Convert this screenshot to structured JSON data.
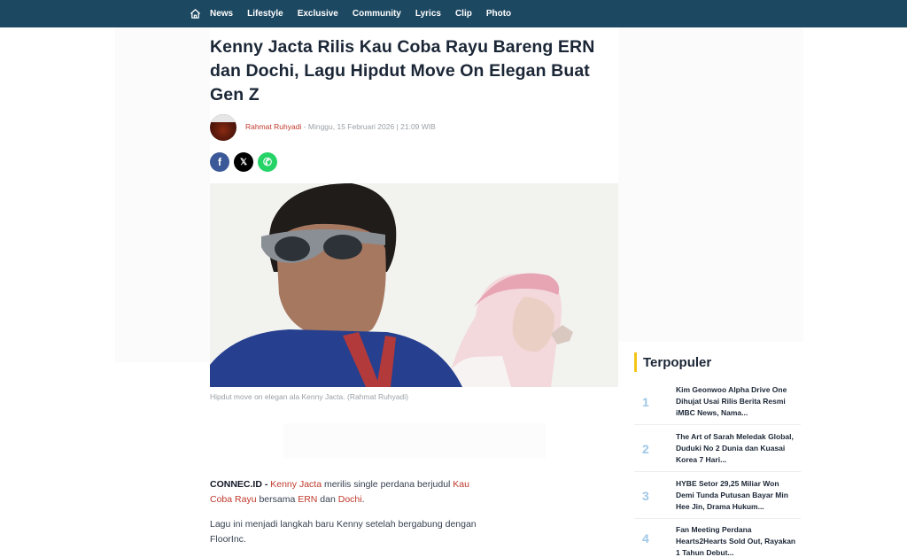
{
  "nav": {
    "home_icon": "home-icon",
    "items": [
      "News",
      "Lifestyle",
      "Exclusive",
      "Community",
      "Lyrics",
      "Clip",
      "Photo"
    ]
  },
  "article": {
    "title": "Kenny Jacta Rilis Kau Coba Rayu Bareng ERN dan Dochi, Lagu Hipdut Move On Elegan Buat Gen Z",
    "author": "Rahmat Ruhyadi",
    "date": " - Minggu, 15 Februari 2026 | 21:09 WIB",
    "share": {
      "facebook": "f",
      "x": "𝕏",
      "whatsapp": "✆"
    },
    "image_caption": "Hipdut move on elegan ala Kenny Jacta. (Rahmat Ruhyadi)",
    "p1": {
      "source": "CONNEC.ID - ",
      "link1": "Kenny Jacta",
      "text1": " merilis single perdana berjudul ",
      "link2": "Kau Coba Rayu",
      "text2": " bersama ",
      "link3": "ERN",
      "text3": " dan ",
      "link4": "Dochi",
      "text4": "."
    },
    "p2": "Lagu ini menjadi langkah baru Kenny setelah bergabung dengan FloorInc."
  },
  "sidebar": {
    "title": "Terpopuler",
    "items": [
      {
        "rank": "1",
        "title": "Kim Geonwoo Alpha Drive One Dihujat Usai Rilis Berita Resmi iMBC News, Nama..."
      },
      {
        "rank": "2",
        "title": "The Art of Sarah Meledak Global, Duduki No 2 Dunia dan Kuasai Korea 7 Hari..."
      },
      {
        "rank": "3",
        "title": "HYBE Setor 29,25 Miliar Won Demi Tunda Putusan Bayar Min Hee Jin, Drama Hukum..."
      },
      {
        "rank": "4",
        "title": "Fan Meeting Perdana Hearts2Hearts Sold Out, Rayakan 1 Tahun Debut..."
      }
    ]
  },
  "colors": {
    "nav_bg": "#1d4862",
    "accent_red": "#c0392b",
    "accent_yellow": "#f5c518",
    "rank_blue": "#9ec7e8"
  }
}
